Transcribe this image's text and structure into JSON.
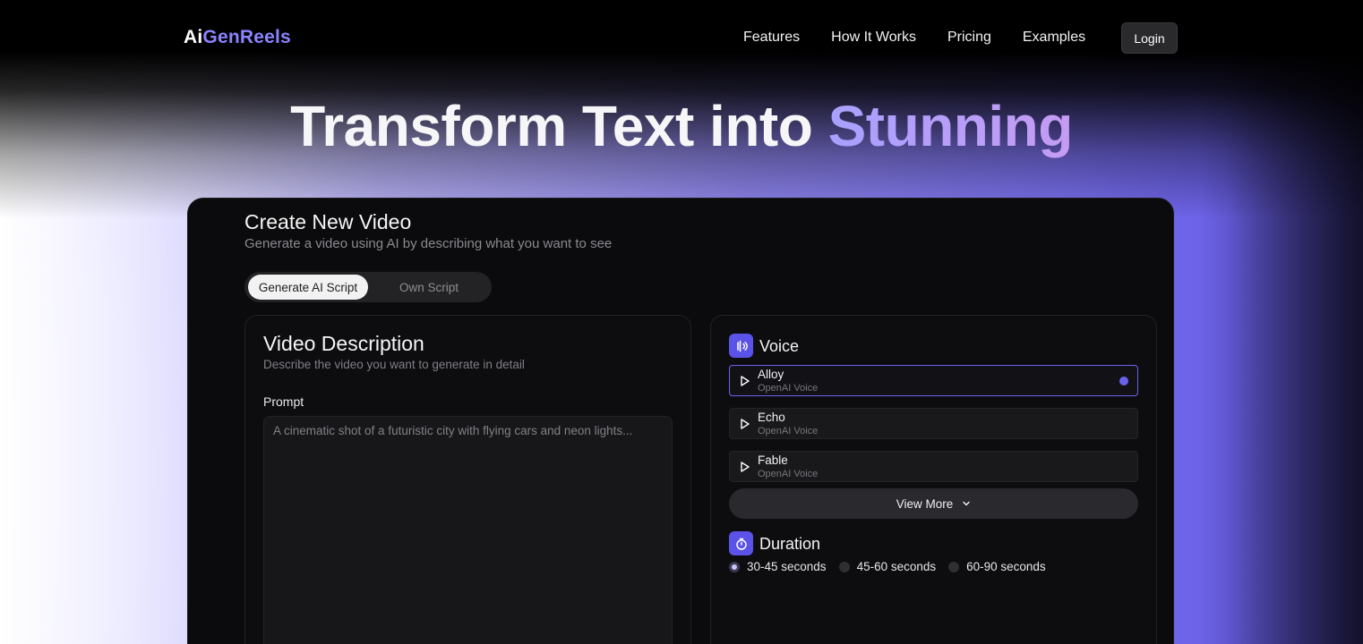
{
  "nav": {
    "logo_part1": "Ai",
    "logo_part2": "GenReels",
    "links": [
      "Features",
      "How It Works",
      "Pricing",
      "Examples"
    ],
    "login_label": "Login"
  },
  "hero": {
    "title_white": "Transform Text into",
    "title_gradient": "Stunning"
  },
  "card": {
    "title": "Create New Video",
    "subtitle": "Generate a video using AI by describing what you want to see",
    "toggle": {
      "active": "Generate AI Script",
      "inactive": "Own Script"
    }
  },
  "video_description": {
    "title": "Video Description",
    "subtitle": "Describe the video you want to generate in detail",
    "prompt_label": "Prompt",
    "prompt_placeholder": "A cinematic shot of a futuristic city with flying cars and neon lights..."
  },
  "voice": {
    "title": "Voice",
    "items": [
      {
        "name": "Alloy",
        "provider": "OpenAI Voice",
        "selected": true
      },
      {
        "name": "Echo",
        "provider": "OpenAI Voice",
        "selected": false
      },
      {
        "name": "Fable",
        "provider": "OpenAI Voice",
        "selected": false
      }
    ],
    "view_more_label": "View More"
  },
  "duration": {
    "title": "Duration",
    "options": [
      {
        "label": "30-45 seconds",
        "selected": true
      },
      {
        "label": "45-60 seconds",
        "selected": false
      },
      {
        "label": "60-90 seconds",
        "selected": false
      }
    ]
  },
  "colors": {
    "accent": "#6a62ef",
    "logo_accent": "#8b83ff"
  }
}
